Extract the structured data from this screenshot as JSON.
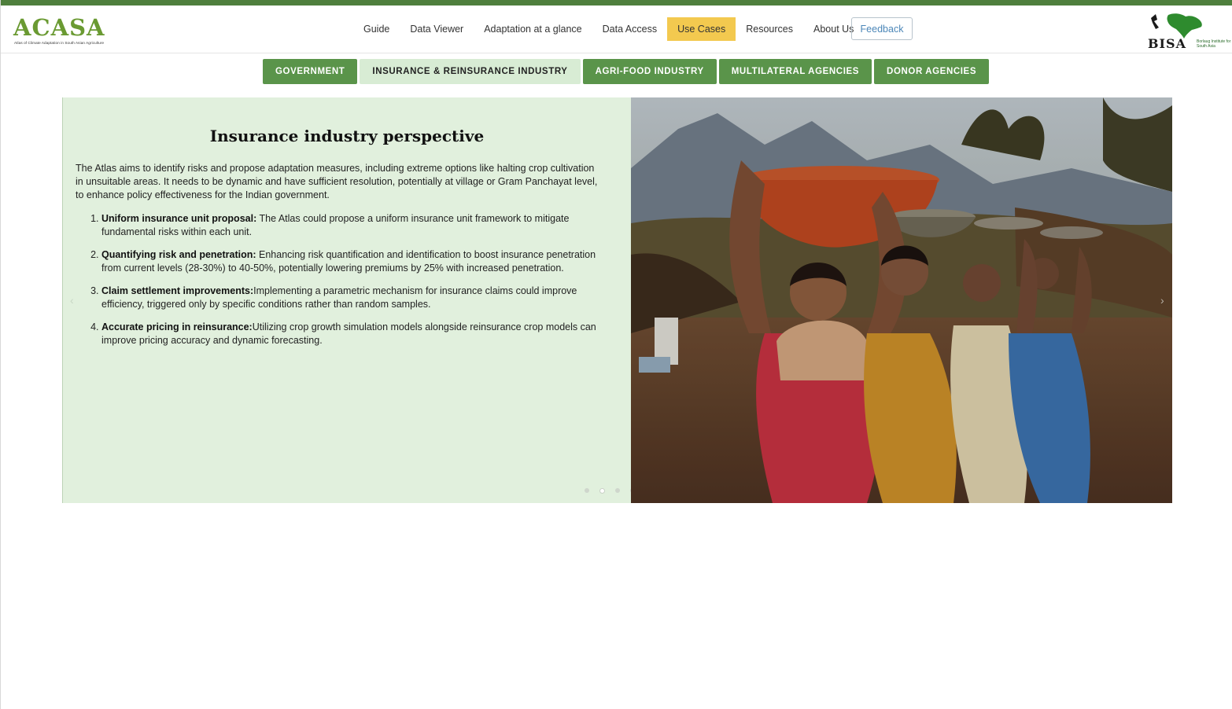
{
  "header": {
    "logo_left": {
      "word": "ACASA",
      "tagline": "Atlas of Climate Adaptation in South Asian Agriculture"
    },
    "nav": [
      {
        "label": "Guide",
        "active": false
      },
      {
        "label": "Data Viewer",
        "active": false
      },
      {
        "label": "Adaptation at a glance",
        "active": false
      },
      {
        "label": "Data Access",
        "active": false
      },
      {
        "label": "Use Cases",
        "active": true
      },
      {
        "label": "Resources",
        "active": false
      },
      {
        "label": "About Us",
        "active": false
      }
    ],
    "feedback_label": "Feedback",
    "logo_right": {
      "word": "BISA",
      "sub": "Borlaug Institute for South Asia"
    }
  },
  "tabs": [
    {
      "label": "GOVERNMENT",
      "active": false
    },
    {
      "label": "INSURANCE & REINSURANCE INDUSTRY",
      "active": true
    },
    {
      "label": "AGRI-FOOD INDUSTRY",
      "active": false
    },
    {
      "label": "MULTILATERAL AGENCIES",
      "active": false
    },
    {
      "label": "DONOR AGENCIES",
      "active": false
    }
  ],
  "slide": {
    "title": "Insurance industry perspective",
    "intro": "The Atlas aims to identify risks and propose adaptation measures, including extreme options like halting crop cultivation in unsuitable areas. It needs to be dynamic and have sufficient resolution, potentially at village or Gram Panchayat level, to enhance policy effectiveness for the Indian government.",
    "points": [
      {
        "heading": "Uniform insurance unit proposal:",
        "text": " The Atlas could propose a uniform insurance unit framework to mitigate fundamental risks within each unit."
      },
      {
        "heading": "Quantifying risk and penetration:",
        "text": " Enhancing risk quantification and identification to boost insurance penetration from current levels (28-30%) to 40-50%, potentially lowering premiums by 25% with increased penetration."
      },
      {
        "heading": "Claim settlement improvements:",
        "text": "Implementing a parametric mechanism for insurance claims could improve efficiency, triggered only by specific conditions rather than random samples."
      },
      {
        "heading": "Accurate pricing in reinsurance:",
        "text": "Utilizing crop growth simulation models alongside reinsurance crop models can improve pricing accuracy and dynamic forecasting."
      }
    ],
    "prev_glyph": "‹",
    "next_glyph": "›",
    "slide_count": 5,
    "active_slide": 2
  },
  "colors": {
    "brand_green": "#5a944a",
    "top_stripe": "#4f7f3d",
    "active_nav": "#f3c94f",
    "panel_bg": "#e1f0dd",
    "active_tab_bg": "#d8ecd4"
  },
  "icons": [
    "acasa-logo",
    "bisa-logo",
    "chevron-left-icon",
    "chevron-right-icon"
  ]
}
